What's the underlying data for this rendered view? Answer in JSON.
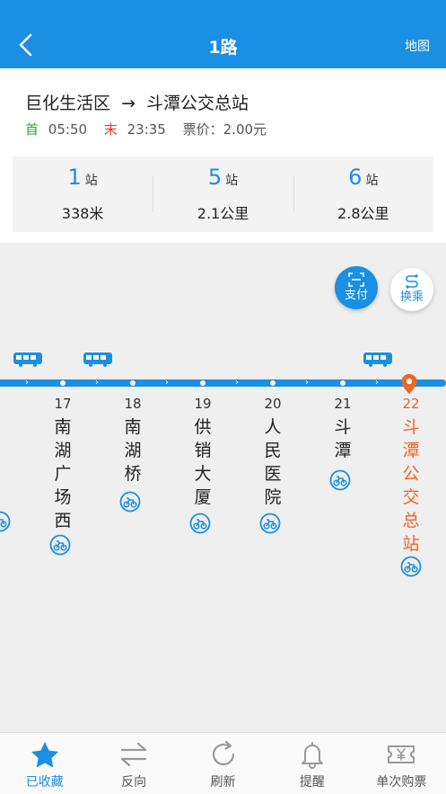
{
  "header": {
    "title": "1路",
    "map_label": "地图"
  },
  "route": {
    "from": "巨化生活区",
    "arrow": "→",
    "to": "斗潭公交总站",
    "first_label": "首",
    "first_time": "05:50",
    "last_label": "末",
    "last_time": "23:35",
    "fare_label": "票价：",
    "fare": "2.00元"
  },
  "stats": [
    {
      "stations": "1",
      "unit": "站",
      "distance": "338米"
    },
    {
      "stations": "5",
      "unit": "站",
      "distance": "2.1公里"
    },
    {
      "stations": "6",
      "unit": "站",
      "distance": "2.8公里"
    }
  ],
  "actions": {
    "pay_label": "支付",
    "transfer_label": "换乘"
  },
  "stops": [
    {
      "index": "17",
      "name": [
        "南",
        "湖",
        "广",
        "场",
        "西"
      ]
    },
    {
      "index": "18",
      "name": [
        "南",
        "湖",
        "桥"
      ]
    },
    {
      "index": "19",
      "name": [
        "供",
        "销",
        "大",
        "厦"
      ]
    },
    {
      "index": "20",
      "name": [
        "人",
        "民",
        "医",
        "院"
      ]
    },
    {
      "index": "21",
      "name": [
        "斗",
        "潭"
      ]
    },
    {
      "index": "22",
      "name": [
        "斗",
        "潭",
        "公",
        "交",
        "总",
        "站"
      ]
    }
  ],
  "tabs": [
    {
      "label": "已收藏"
    },
    {
      "label": "反向"
    },
    {
      "label": "刷新"
    },
    {
      "label": "提醒"
    },
    {
      "label": "单次购票"
    }
  ],
  "colors": {
    "primary": "#1a8fe3",
    "terminal": "#f06428",
    "first": "#2aa836",
    "last": "#e23b2e"
  }
}
